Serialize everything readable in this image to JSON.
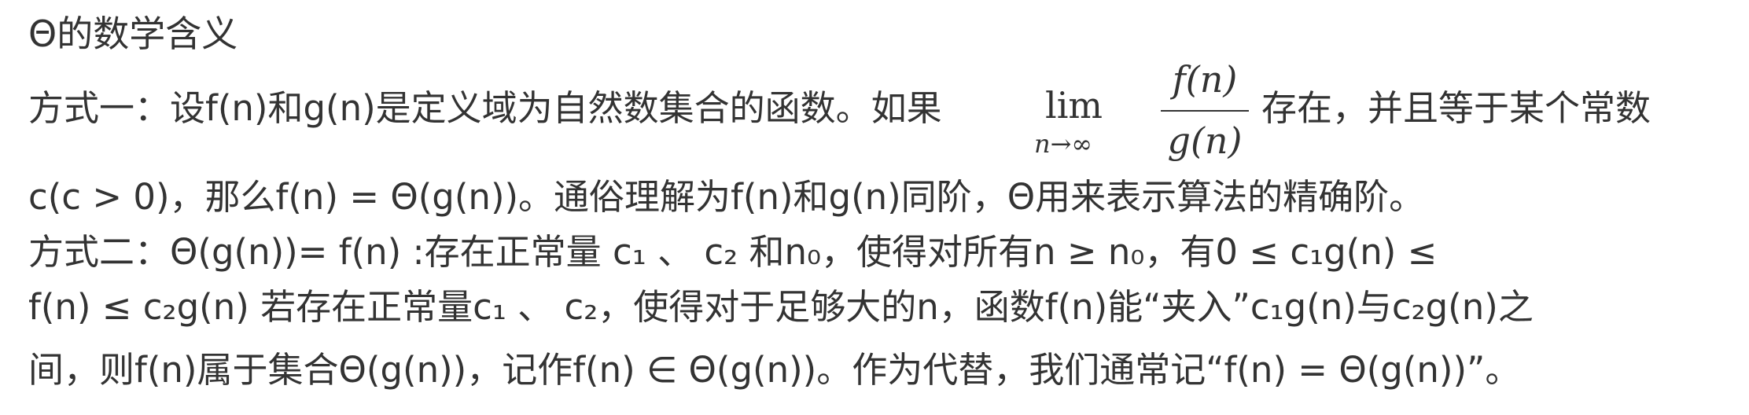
{
  "heading": "Θ的数学含义",
  "line1": {
    "prefix": "方式一：设f(n)和g(n)是定义域为自然数集合的函数。如果",
    "lim_word": "lim",
    "lim_sub": "n→∞",
    "fraction_num": "f(n)",
    "fraction_den": "g(n)",
    "suffix": "存在，并且等于某个常数"
  },
  "line2": "c(c > 0)，那么f(n) = Θ(g(n))。通俗理解为f(n)和g(n)同阶，Θ用来表示算法的精确阶。",
  "line3": "方式二：Θ(g(n))= f(n) :存在正常量 c₁ 、 c₂ 和n₀，使得对所有n ≥ n₀，有0 ≤ c₁g(n) ≤",
  "line4": "f(n) ≤ c₂g(n) 若存在正常量c₁ 、 c₂，使得对于足够大的n，函数f(n)能“夹入”c₁g(n)与c₂g(n)之",
  "line5": "间，则f(n)属于集合Θ(g(n))，记作f(n) ∈ Θ(g(n))。作为代替，我们通常记“f(n) = Θ(g(n))”。"
}
